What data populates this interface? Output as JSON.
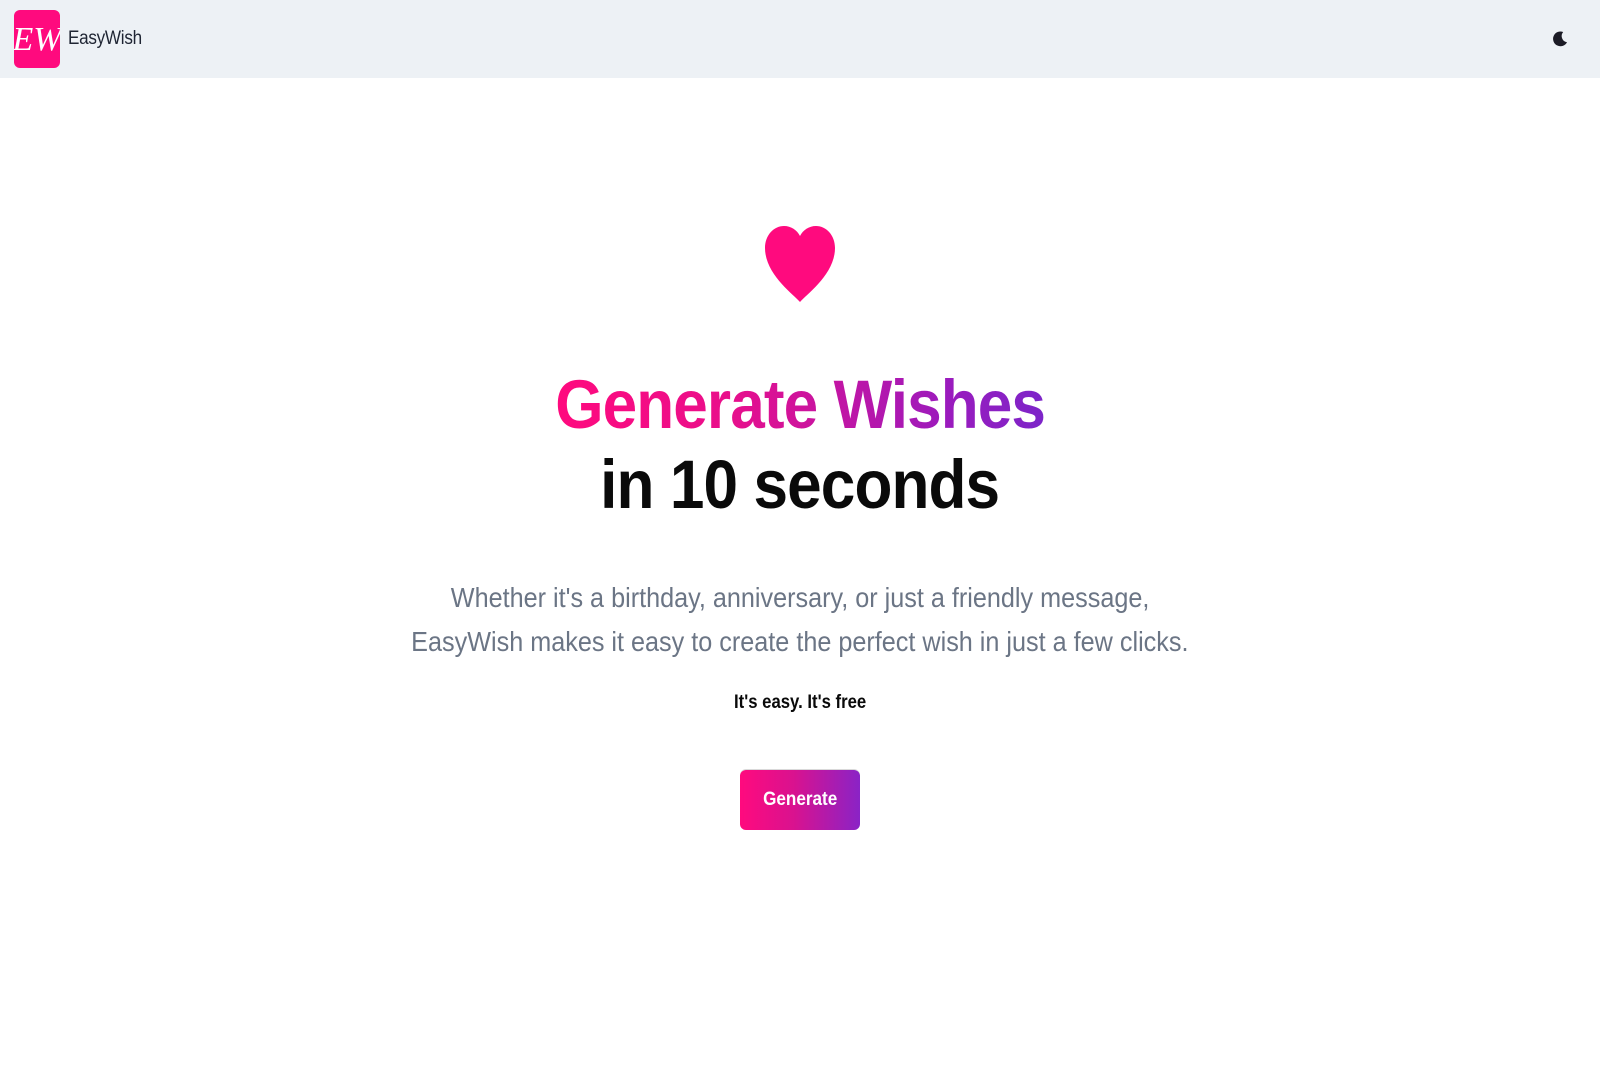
{
  "navbar": {
    "brand_name": "EasyWish",
    "logo_text": "EW",
    "logo_color": "#ff0a7e",
    "background": "#edf1f5",
    "theme_toggle_icon": "moon-icon"
  },
  "hero": {
    "icon": "heart-icon",
    "icon_color": "#ff0a7e",
    "headline_line1": "Generate Wishes",
    "headline_line2": "in 10 seconds",
    "gradient_colors": [
      "#ff0a7e",
      "#7c25c9"
    ],
    "description_line1": "Whether it's a birthday, anniversary, or just a friendly message,",
    "description_line2": "EasyWish makes it easy to create the perfect wish in just a few clicks.",
    "tagline": "It's easy. It's free",
    "cta_label": "Generate"
  }
}
